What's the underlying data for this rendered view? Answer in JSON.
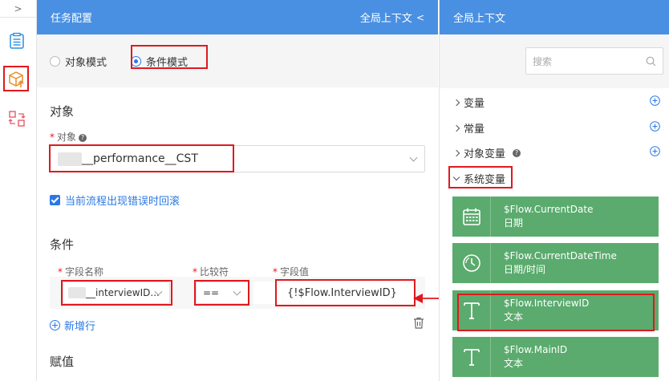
{
  "left_header": {
    "title": "任务配置",
    "context_link": "全局上下文"
  },
  "mode": {
    "options": [
      {
        "label": "对象模式",
        "selected": false
      },
      {
        "label": "条件模式",
        "selected": true
      }
    ]
  },
  "object_section": {
    "title": "对象",
    "field_label": "对象",
    "field_value": "__performance__CST"
  },
  "rollback": {
    "label": "当前流程出现错误时回滚",
    "checked": true
  },
  "condition_section": {
    "title": "条件",
    "columns": [
      "字段名称",
      "比较符",
      "字段值"
    ],
    "row": {
      "field_name": "__interviewID...",
      "operator": "==",
      "field_value": "{!$Flow.InterviewID}"
    },
    "add_row_label": "新增行"
  },
  "assign_section": {
    "title": "赋值"
  },
  "right_panel": {
    "title": "全局上下文",
    "search_placeholder": "搜索",
    "tree": [
      {
        "label": "变量",
        "expanded": false
      },
      {
        "label": "常量",
        "expanded": false
      },
      {
        "label": "对象变量",
        "expanded": false
      },
      {
        "label": "系统变量",
        "expanded": true
      }
    ],
    "system_vars": [
      {
        "name": "$Flow.CurrentDate",
        "type": "日期",
        "icon": "calendar-icon"
      },
      {
        "name": "$Flow.CurrentDateTime",
        "type": "日期/时间",
        "icon": "clock-icon"
      },
      {
        "name": "$Flow.InterviewID",
        "type": "文本",
        "icon": "text-icon"
      },
      {
        "name": "$Flow.MainID",
        "type": "文本",
        "icon": "text-icon"
      }
    ]
  },
  "colors": {
    "header_blue": "#4a90e2",
    "accent_blue": "#2a78e4",
    "card_green": "#5aab6d",
    "highlight_red": "#e0191e"
  }
}
